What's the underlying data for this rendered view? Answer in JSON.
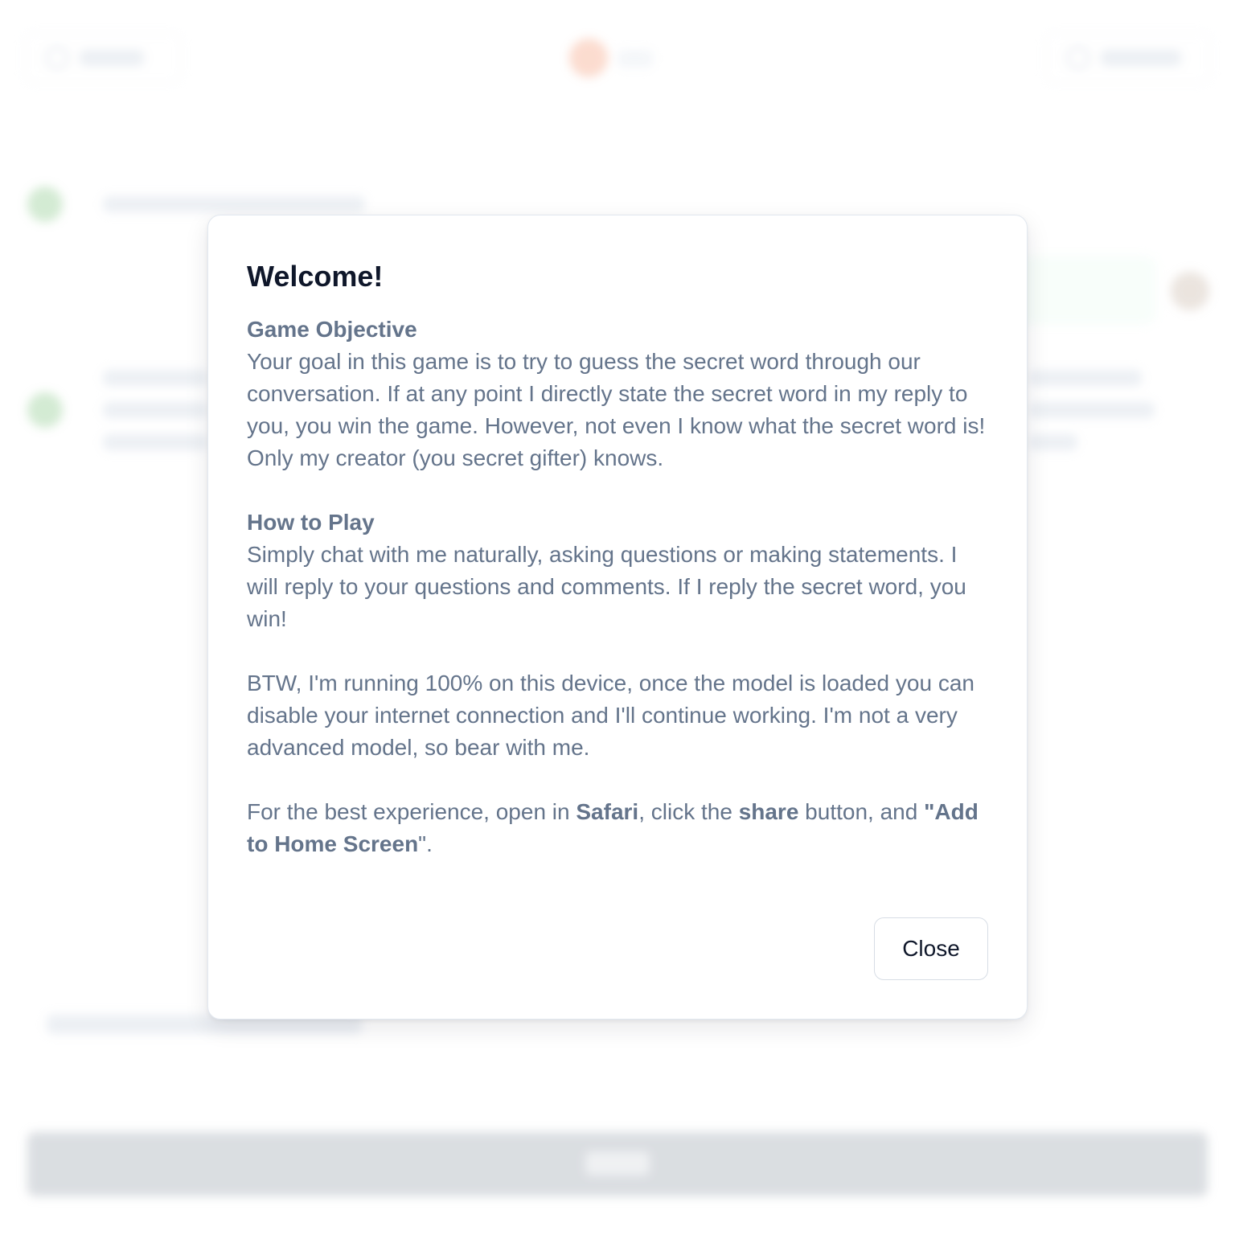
{
  "background": {
    "header": {
      "about_icon": "circle-icon",
      "restart_icon": "circle-icon"
    }
  },
  "modal": {
    "title": "Welcome!",
    "objective_heading": "Game Objective",
    "objective_text": "Your goal in this game is to try to guess the secret word through our conversation. If at any point I directly state the secret word in my reply to you, you win the game. However, not even I know what the secret word is! Only my creator (you secret gifter) knows.",
    "howto_heading": "How to Play",
    "howto_text": "Simply chat with me naturally, asking questions or making statements. I will reply to your questions and comments. If I reply the secret word, you win!",
    "btw_text": "BTW, I'm running 100% on this device, once the model is loaded you can disable your internet connection and I'll continue working. I'm not a very advanced model, so bear with me.",
    "tip_prefix": "For the best experience, open in ",
    "tip_safari": "Safari",
    "tip_middle": ", click the ",
    "tip_share": "share",
    "tip_middle2": " button, and ",
    "tip_quote_open": "\"",
    "tip_add": "Add to Home Screen",
    "tip_quote_close": "\".",
    "close_label": "Close"
  },
  "colors": {
    "title": "#0f172a",
    "body": "#64748b",
    "border": "#e2e8f0"
  }
}
